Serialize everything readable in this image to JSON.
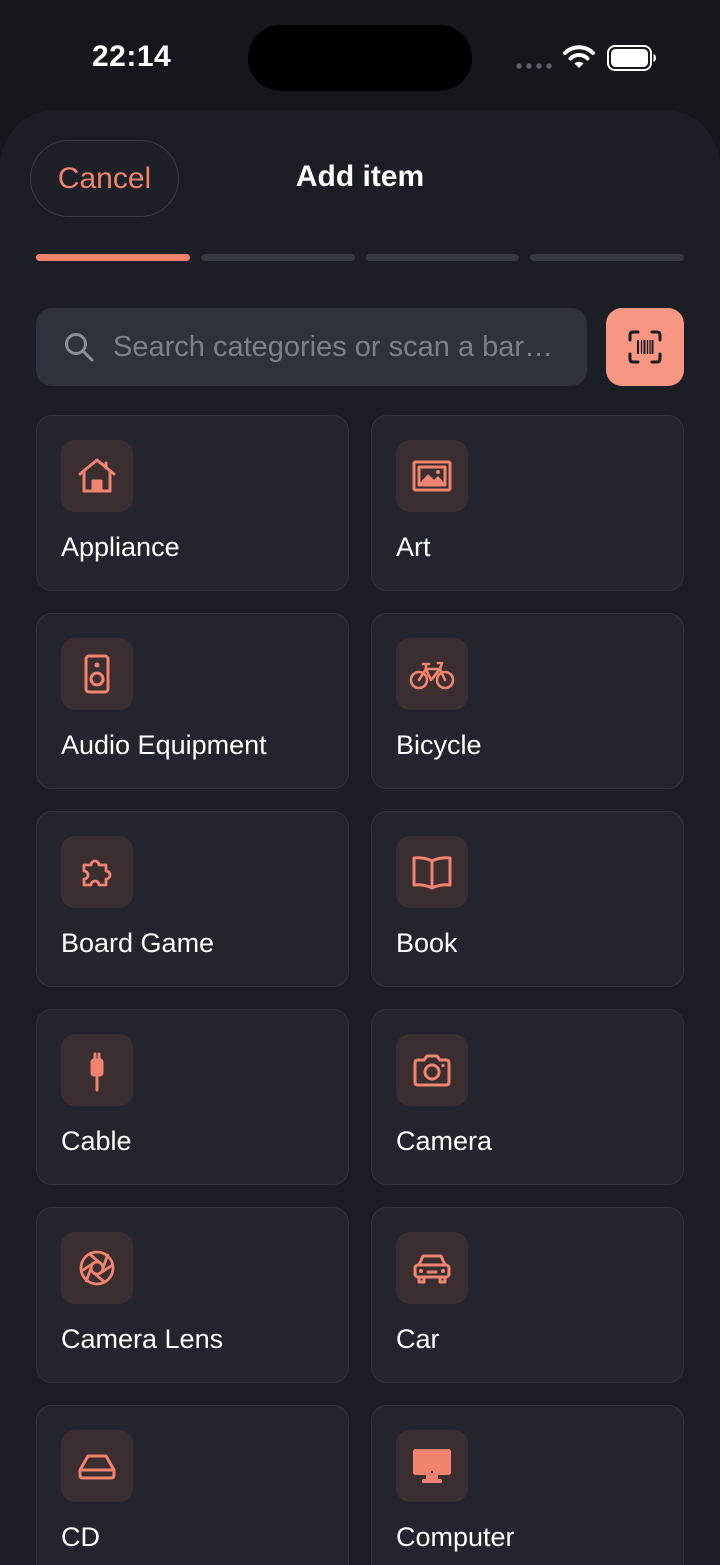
{
  "status_bar": {
    "time": "22:14"
  },
  "header": {
    "cancel_label": "Cancel",
    "title": "Add item"
  },
  "progress": {
    "total_steps": 4,
    "current_step": 1
  },
  "search": {
    "placeholder": "Search categories or scan a barcode",
    "value": ""
  },
  "categories": [
    {
      "label": "Appliance",
      "icon": "house-icon"
    },
    {
      "label": "Art",
      "icon": "picture-icon"
    },
    {
      "label": "Audio Equipment",
      "icon": "speaker-icon"
    },
    {
      "label": "Bicycle",
      "icon": "bicycle-icon"
    },
    {
      "label": "Board Game",
      "icon": "puzzle-icon"
    },
    {
      "label": "Book",
      "icon": "book-icon"
    },
    {
      "label": "Cable",
      "icon": "cable-icon"
    },
    {
      "label": "Camera",
      "icon": "camera-icon"
    },
    {
      "label": "Camera Lens",
      "icon": "aperture-icon"
    },
    {
      "label": "Car",
      "icon": "car-icon"
    },
    {
      "label": "CD",
      "icon": "disc-drive-icon"
    },
    {
      "label": "Computer",
      "icon": "monitor-icon"
    }
  ],
  "colors": {
    "accent": "#f2846f",
    "scan_button": "#f79682",
    "background": "#1b1e25",
    "card": "#22252e"
  }
}
